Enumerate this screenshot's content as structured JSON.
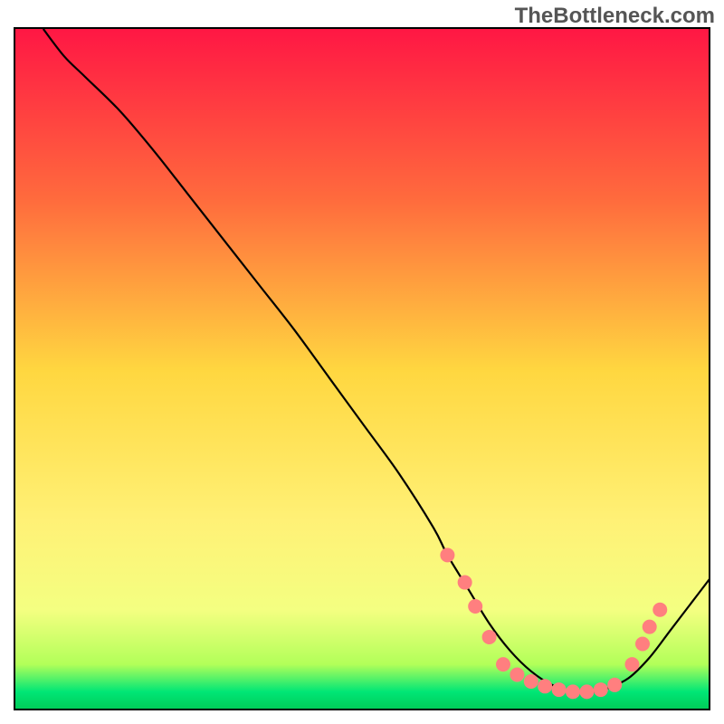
{
  "watermark": "TheBottleneck.com",
  "chart_data": {
    "type": "line",
    "title": "",
    "xlabel": "",
    "ylabel": "",
    "xlim": [
      0,
      100
    ],
    "ylim": [
      0,
      100
    ],
    "gradient": {
      "stops": [
        {
          "offset": 0,
          "color": "#ff1744"
        },
        {
          "offset": 25,
          "color": "#ff6b3d"
        },
        {
          "offset": 50,
          "color": "#ffd740"
        },
        {
          "offset": 72,
          "color": "#fff176"
        },
        {
          "offset": 85,
          "color": "#f4ff81"
        },
        {
          "offset": 93,
          "color": "#b2ff59"
        },
        {
          "offset": 97,
          "color": "#00e676"
        },
        {
          "offset": 100,
          "color": "#00c853"
        }
      ]
    },
    "series": [
      {
        "name": "bottleneck-curve",
        "x": [
          4,
          7,
          10,
          15,
          20,
          25,
          30,
          35,
          40,
          45,
          50,
          55,
          60,
          62,
          65,
          68,
          71,
          74,
          77,
          80,
          83,
          85,
          88,
          91,
          94,
          97,
          100
        ],
        "y": [
          100,
          96,
          93,
          88,
          82,
          75.5,
          69,
          62.5,
          56,
          49,
          42,
          35,
          27,
          23,
          18,
          13,
          9,
          6,
          4,
          3,
          3,
          3.5,
          5,
          8,
          12,
          16,
          20
        ]
      }
    ],
    "dots": {
      "name": "highlight-dots",
      "color": "#ff7f7f",
      "radius": 8,
      "points": [
        {
          "x": 62,
          "y": 23
        },
        {
          "x": 64.5,
          "y": 19
        },
        {
          "x": 66,
          "y": 15.5
        },
        {
          "x": 68,
          "y": 11
        },
        {
          "x": 70,
          "y": 7
        },
        {
          "x": 72,
          "y": 5.5
        },
        {
          "x": 74,
          "y": 4.5
        },
        {
          "x": 76,
          "y": 3.8
        },
        {
          "x": 78,
          "y": 3.3
        },
        {
          "x": 80,
          "y": 3
        },
        {
          "x": 82,
          "y": 3
        },
        {
          "x": 84,
          "y": 3.3
        },
        {
          "x": 86,
          "y": 4
        },
        {
          "x": 88.5,
          "y": 7
        },
        {
          "x": 90,
          "y": 10
        },
        {
          "x": 91,
          "y": 12.5
        },
        {
          "x": 92.5,
          "y": 15
        }
      ]
    }
  }
}
